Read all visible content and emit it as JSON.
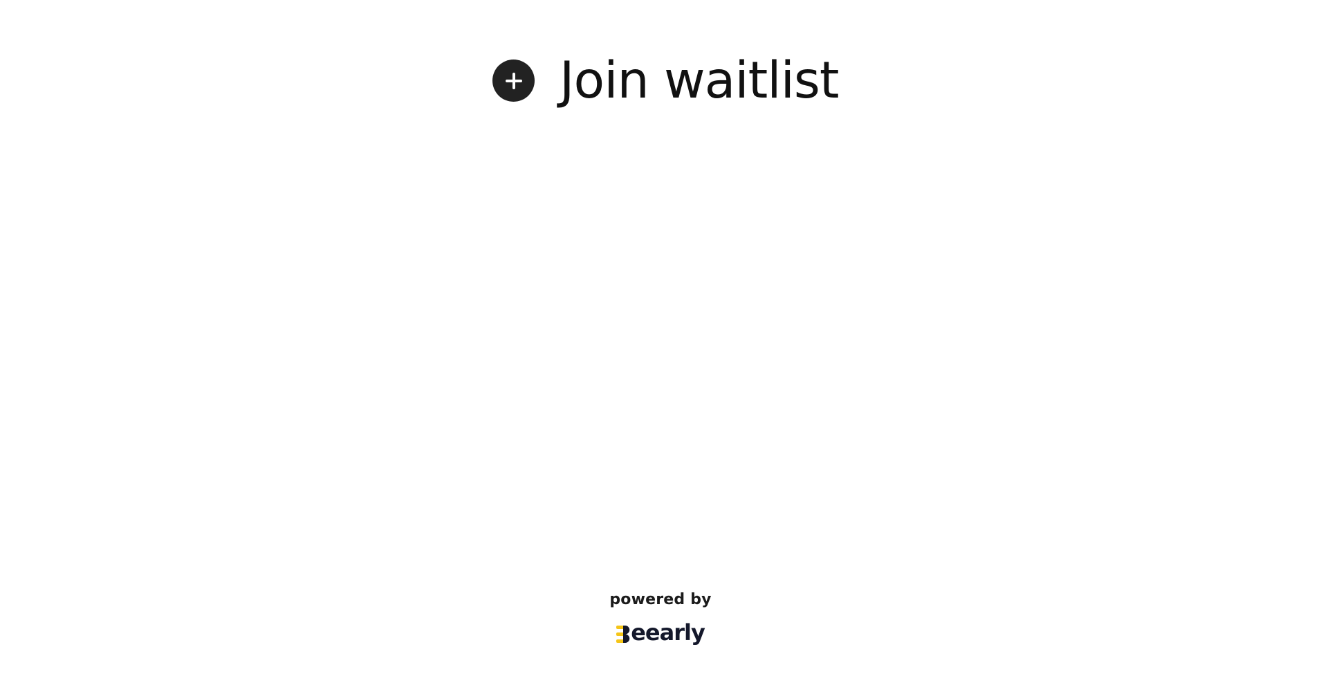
{
  "header": {
    "icon": "plus-circle-icon",
    "title": "Join waitlist"
  },
  "footer": {
    "powered_by": "powered by",
    "brand_name": "Beearly",
    "brand_name_rest": "eearly",
    "brand_mark_icon": "bee-logo-icon"
  },
  "colors": {
    "icon_bg": "#222222",
    "text": "#111111",
    "brand_text": "#14182b",
    "brand_accent": "#f5c518"
  }
}
